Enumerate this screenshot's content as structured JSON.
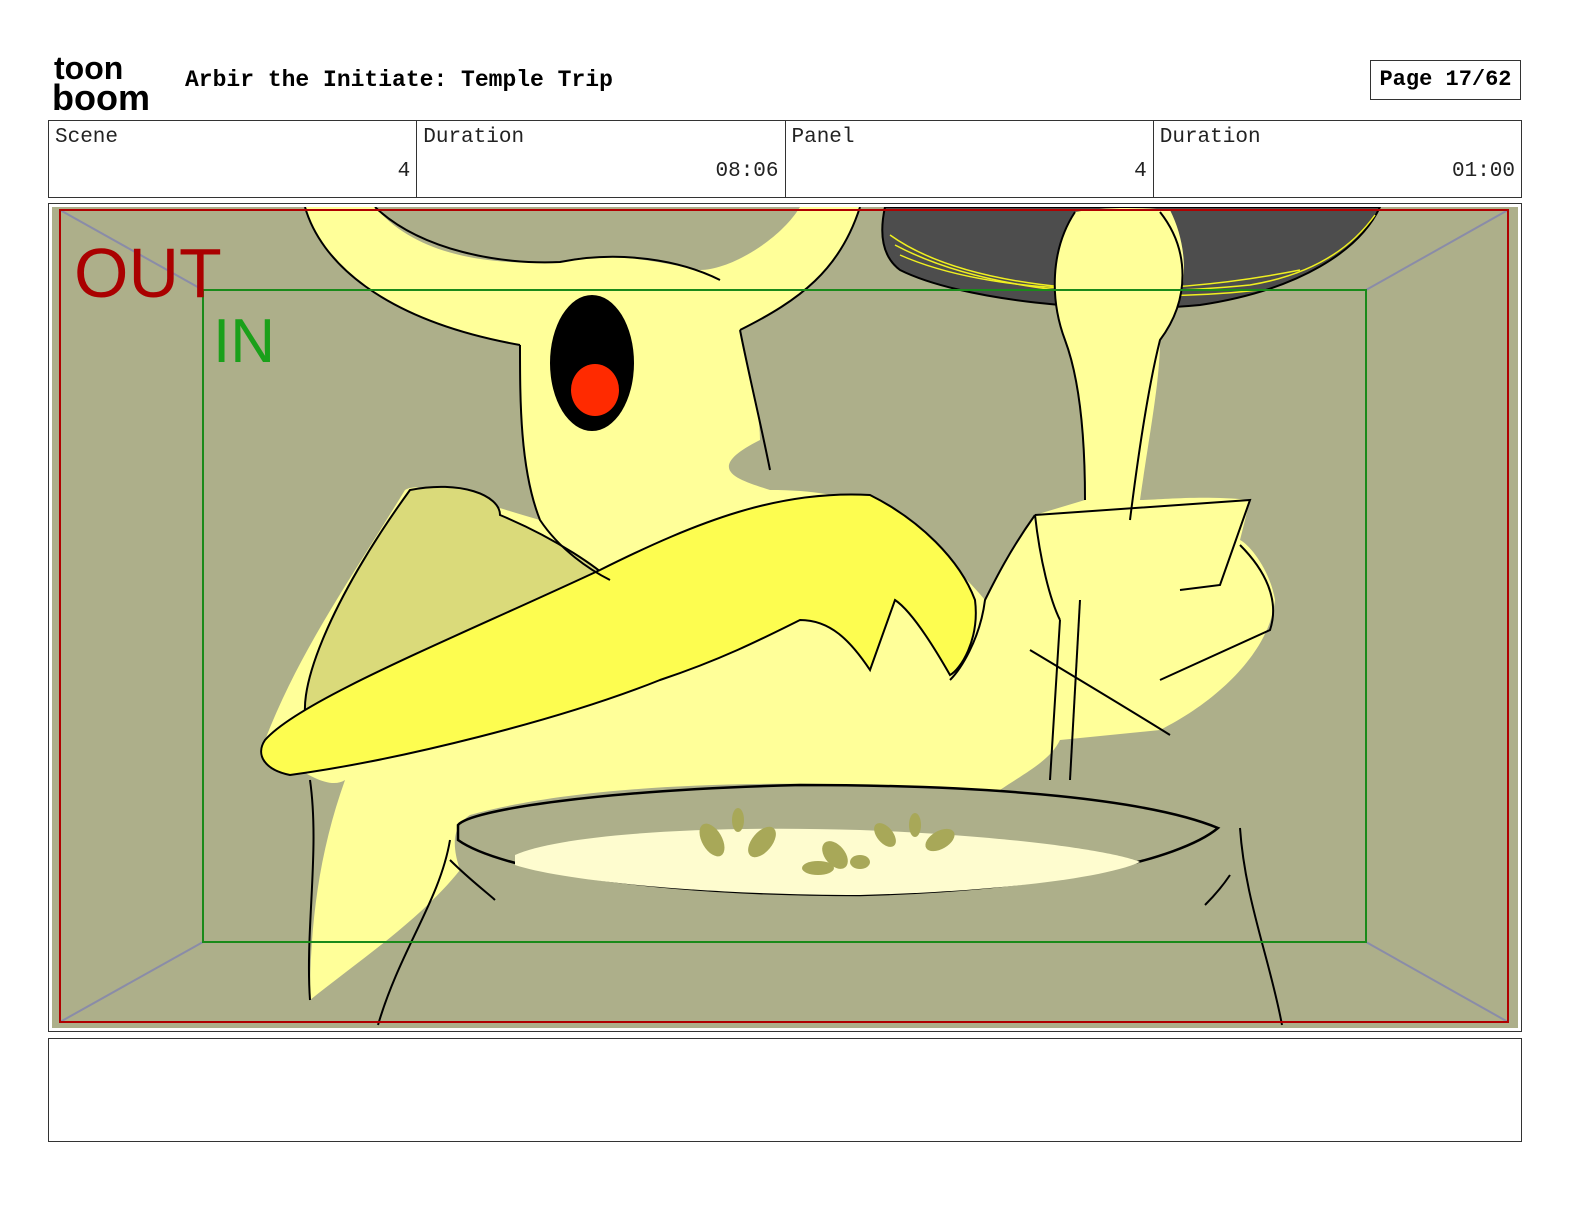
{
  "header": {
    "logo_line1": "toon",
    "logo_line2": "boom",
    "project_title": "Arbir the Initiate: Temple Trip",
    "page": "Page 17/62"
  },
  "info": {
    "scene_label": "Scene",
    "scene_value": "4",
    "scene_duration_label": "Duration",
    "scene_duration_value": "08:06",
    "panel_label": "Panel",
    "panel_value": "4",
    "panel_duration_label": "Duration",
    "panel_duration_value": "01:00"
  },
  "panel": {
    "safe_frame_out_label": "OUT",
    "safe_frame_in_label": "IN",
    "colors": {
      "background": "#adaf8a",
      "creature": "#ffff99",
      "arm_highlight": "#fdfd50",
      "eye": "#000000",
      "pupil": "#ff2a00",
      "pot_rim": "#fefccf",
      "ladle_pan": "#4d4d4d",
      "out_frame": "#b00000",
      "in_frame": "#1a8a1a"
    }
  },
  "notes": {
    "text": ""
  }
}
